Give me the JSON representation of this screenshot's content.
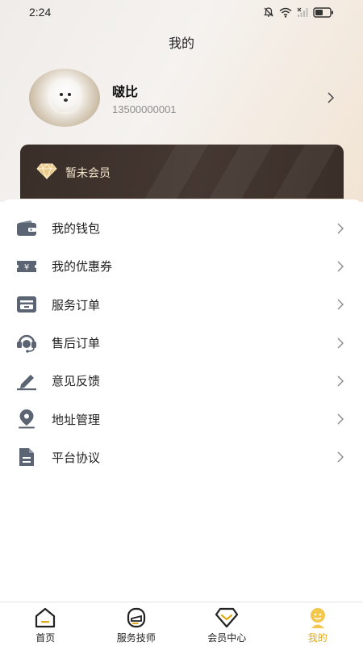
{
  "status_bar": {
    "time": "2:24",
    "icons": [
      "mute-bell-icon",
      "wifi-icon",
      "no-signal-icon",
      "battery-icon"
    ]
  },
  "header": {
    "title": "我的"
  },
  "profile": {
    "name": "啵比",
    "phone": "13500000001",
    "avatar_icon": "dog-avatar"
  },
  "member_card": {
    "label": "暂未会员",
    "icon": "diamond-icon"
  },
  "menu": {
    "items": [
      {
        "label": "我的钱包",
        "icon": "wallet-icon"
      },
      {
        "label": "我的优惠券",
        "icon": "coupon-icon"
      },
      {
        "label": "服务订单",
        "icon": "service-order-icon"
      },
      {
        "label": "售后订单",
        "icon": "headset-icon"
      },
      {
        "label": "意见反馈",
        "icon": "edit-icon"
      },
      {
        "label": "地址管理",
        "icon": "location-icon"
      },
      {
        "label": "平台协议",
        "icon": "document-icon"
      }
    ]
  },
  "tabbar": {
    "tabs": [
      {
        "label": "首页",
        "icon": "home-icon",
        "active": false
      },
      {
        "label": "服务技师",
        "icon": "technician-icon",
        "active": false
      },
      {
        "label": "会员中心",
        "icon": "member-center-icon",
        "active": false
      },
      {
        "label": "我的",
        "icon": "mine-icon",
        "active": true
      }
    ]
  },
  "colors": {
    "accent": "#e0a91b",
    "card_bg": "#3f332d",
    "card_text": "#f3e6cc",
    "icon_gray": "#5b6472"
  }
}
